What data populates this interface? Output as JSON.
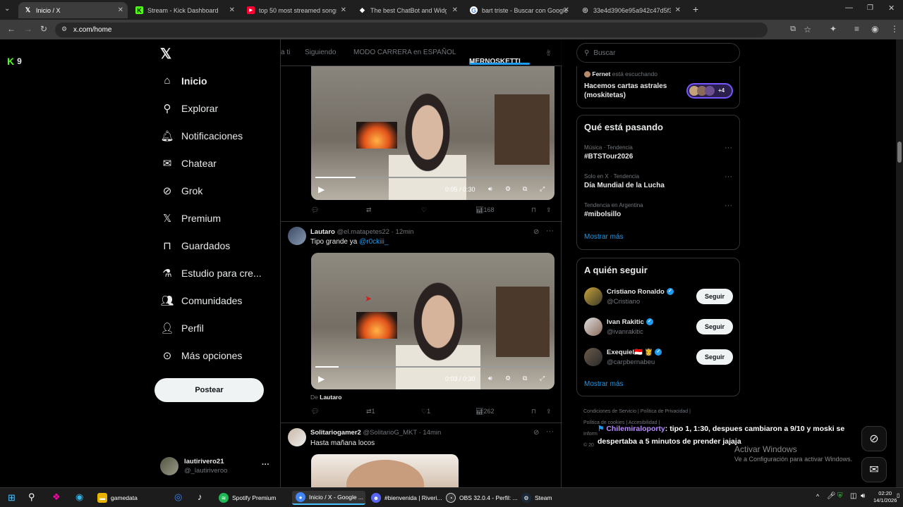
{
  "browser": {
    "tabs": [
      {
        "label": "Inicio / X",
        "icon": "x-logo-icon",
        "active": true
      },
      {
        "label": "Stream - Kick Dashboard",
        "icon": "kick-icon"
      },
      {
        "label": "top 50 most streamed songs fr",
        "icon": "youtube-icon"
      },
      {
        "label": "The best ChatBot and Widgets",
        "icon": "chatbot-icon"
      },
      {
        "label": "bart triste - Buscar con Google",
        "icon": "google-icon"
      },
      {
        "label": "33e4d3906e95a942c47d5f3672",
        "icon": "globe-icon"
      }
    ],
    "url": "x.com/home"
  },
  "overlay": {
    "kick_viewers": "9"
  },
  "sidebar": {
    "items": [
      {
        "label": "Inicio",
        "icon": "home-icon"
      },
      {
        "label": "Explorar",
        "icon": "search-icon"
      },
      {
        "label": "Notificaciones",
        "icon": "bell-icon"
      },
      {
        "label": "Chatear",
        "icon": "mail-icon"
      },
      {
        "label": "Grok",
        "icon": "grok-icon"
      },
      {
        "label": "Premium",
        "icon": "x-logo-icon"
      },
      {
        "label": "Guardados",
        "icon": "bookmark-icon"
      },
      {
        "label": "Estudio para cre...",
        "icon": "flask-icon"
      },
      {
        "label": "Comunidades",
        "icon": "people-icon"
      },
      {
        "label": "Perfil",
        "icon": "person-icon"
      },
      {
        "label": "Más opciones",
        "icon": "more-icon"
      }
    ],
    "post_label": "Postear",
    "account": {
      "name": "lautirivero21",
      "handle": "@_lautiriveroo",
      "more": "···"
    }
  },
  "feed": {
    "tabs": [
      "a ti",
      "Siguiendo",
      "MODO CARRERA en ESPAÑOL",
      "MERNOSKETTI"
    ],
    "tweet1": {
      "time": "0:05 / 0:30",
      "progress": 0.17,
      "views": "168"
    },
    "tweet2": {
      "name": "Lautaro",
      "handle": "@el.matapetes22",
      "time_ago": "· 12min",
      "text": "Tipo grande ya",
      "mention": "@r0ckiii_",
      "video_time": "0:03 / 0:30",
      "progress": 0.1,
      "from_prefix": "De",
      "from_name": "Lautaro",
      "retweets": "1",
      "likes": "1",
      "views": "262"
    },
    "tweet3": {
      "name": "Solitariogamer2",
      "handle": "@SolitarioG_MKT",
      "time_ago": "· 14min",
      "text": "Hasta mañana locos"
    }
  },
  "right": {
    "search_placeholder": "Buscar",
    "space": {
      "host": "Fernet",
      "status": "está escuchando",
      "title": "Hacemos cartas astrales (moskitetas)",
      "more": "+4"
    },
    "trends_title": "Qué está pasando",
    "trends": [
      {
        "meta": "Música · Tendencia",
        "name": "#BTSTour2026"
      },
      {
        "meta": "Solo en X · Tendencia",
        "name": "Día Mundial de la Lucha"
      },
      {
        "meta": "Tendencia en Argentina",
        "name": "#mibolsillo"
      }
    ],
    "show_more": "Mostrar más",
    "follow_title": "A quién seguir",
    "follow": [
      {
        "name": "Cristiano Ronaldo",
        "handle": "@Cristiano",
        "button": "Seguir"
      },
      {
        "name": "Ivan Rakitic",
        "handle": "@ivanrakitic",
        "button": "Seguir"
      },
      {
        "name": "Exequiel🇮🇩 👸",
        "handle": "@carpbernabeu",
        "button": "Seguir"
      }
    ],
    "show_more2": "Mostrar más",
    "footer": [
      "Condiciones de Servicio",
      "Política de Privacidad",
      "Política de cookies",
      "Accesibilidad",
      "Inform",
      "© 20"
    ]
  },
  "chat_overlay": {
    "user": "Chilemiraloporty",
    "message": ": tipo 1, 1:30, despues cambiaron a 9/10 y moski se despertaba a 5 minutos de prender jajaja"
  },
  "watermark": {
    "title": "Activar Windows",
    "subtitle": "Ve a Configuración para activar Windows."
  },
  "taskbar": {
    "apps": [
      {
        "label": "gamedata",
        "icon": "folder-icon",
        "color": "#e8b300"
      },
      {
        "label": "Spotify Premium",
        "icon": "spotify-icon",
        "color": "#1db954"
      },
      {
        "label": "Inicio / X - Google ...",
        "icon": "chrome-icon",
        "color": "#4285f4"
      },
      {
        "label": "#bienvenida | Riveri...",
        "icon": "discord-icon",
        "color": "#5865f2"
      },
      {
        "label": "OBS 32.0.4 - Perfil: ...",
        "icon": "obs-icon",
        "color": "#333"
      },
      {
        "label": "Steam",
        "icon": "steam-icon",
        "color": "#1b2838"
      }
    ],
    "time": "02:20",
    "date": "14/1/2026"
  }
}
